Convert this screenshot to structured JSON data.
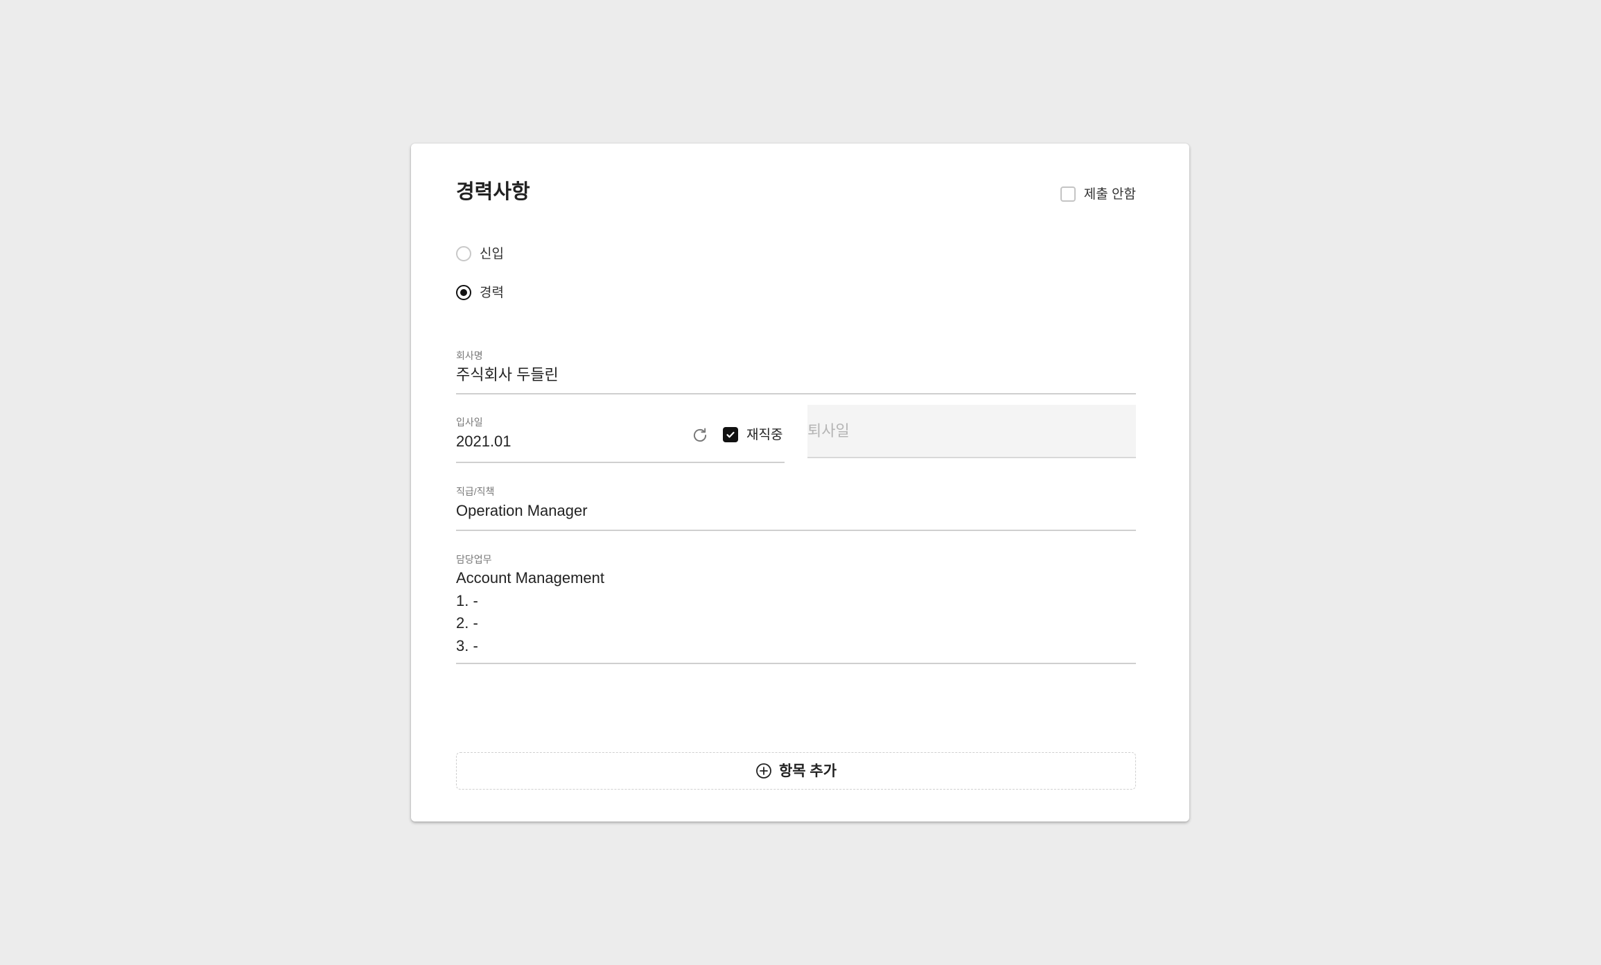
{
  "section": {
    "title": "경력사항",
    "no_submit_label": "제출 안함"
  },
  "career_type": {
    "options": [
      {
        "label": "신입",
        "selected": false
      },
      {
        "label": "경력",
        "selected": true
      }
    ]
  },
  "company": {
    "label": "회사명",
    "value": "주식회사 두들린"
  },
  "start_date": {
    "label": "입사일",
    "value": "2021.01",
    "employed_label": "재직중",
    "employed_checked": true
  },
  "end_date": {
    "placeholder": "퇴사일"
  },
  "position": {
    "label": "직급/직책",
    "value": "Operation Manager"
  },
  "duties": {
    "label": "담당업무",
    "value": "Account Management\n1. -\n2. -\n3. -"
  },
  "add_item": {
    "label": "항목 추가"
  },
  "icons": {
    "reset": "refresh-icon",
    "add": "plus-circle-icon",
    "check": "check-icon"
  }
}
